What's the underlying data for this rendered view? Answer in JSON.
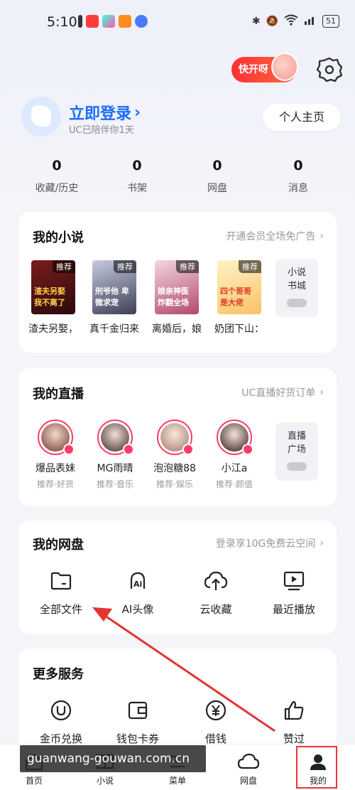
{
  "status_bar": {
    "time": "5:10",
    "battery": "51"
  },
  "header": {
    "promo_badge": "快开呀"
  },
  "profile": {
    "login_label": "立即登录",
    "subtitle": "UC已陪伴你1天",
    "profile_button": "个人主页"
  },
  "stats": [
    {
      "value": "0",
      "label": "收藏/历史"
    },
    {
      "value": "0",
      "label": "书架"
    },
    {
      "value": "0",
      "label": "网盘"
    },
    {
      "value": "0",
      "label": "消息"
    }
  ],
  "novels": {
    "title": "我的小说",
    "link": "开通会员全场免广告",
    "books": [
      {
        "name": "渣夫另娶，",
        "tag": "推荐",
        "cover_text": "渣夫另娶 我不离了"
      },
      {
        "name": "真千金归来",
        "tag": "推荐",
        "cover_text": "刑爷他 卑微求宠"
      },
      {
        "name": "离婚后，娘",
        "tag": "推荐",
        "cover_text": "娘亲神医 炸翻全场"
      },
      {
        "name": "奶团下山：",
        "tag": "推荐",
        "cover_text": "四个哥哥 是大佬"
      }
    ],
    "more_tile": [
      "小说",
      "书城"
    ]
  },
  "live": {
    "title": "我的直播",
    "link": "UC直播好货订单",
    "streamers": [
      {
        "name": "爆品表妹",
        "sub": "推荐·好货"
      },
      {
        "name": "MG雨晴",
        "sub": "推荐·音乐"
      },
      {
        "name": "泡泡糖88",
        "sub": "推荐·娱乐"
      },
      {
        "name": "小江a",
        "sub": "推荐·颜值"
      }
    ],
    "more_tile": [
      "直播",
      "广场"
    ]
  },
  "netdisk": {
    "title": "我的网盘",
    "link": "登录享10G免费云空间",
    "items": [
      {
        "label": "全部文件",
        "icon": "folder-icon"
      },
      {
        "label": "AI头像",
        "icon": "ai-avatar-icon"
      },
      {
        "label": "云收藏",
        "icon": "cloud-upload-icon"
      },
      {
        "label": "最近播放",
        "icon": "play-screen-icon"
      }
    ]
  },
  "services": {
    "title": "更多服务",
    "items": [
      {
        "label": "金币兑换",
        "icon": "coin-icon"
      },
      {
        "label": "钱包卡券",
        "icon": "wallet-icon"
      },
      {
        "label": "借钱",
        "icon": "yuan-icon"
      },
      {
        "label": "赞过",
        "icon": "thumbs-up-icon"
      }
    ]
  },
  "bottom_nav": [
    {
      "label": "首页",
      "icon": "home-icon"
    },
    {
      "label": "小说",
      "icon": "book-icon"
    },
    {
      "label": "菜单",
      "icon": "menu-icon"
    },
    {
      "label": "网盘",
      "icon": "cloud-icon"
    },
    {
      "label": "我的",
      "icon": "profile-icon"
    }
  ],
  "watermark": "guanwang-gouwan.com.cn",
  "colors": {
    "accent": "#1b6cff",
    "live_ring": "#ff3a6a",
    "promo": "#ff2f38",
    "annotation": "#e33333"
  }
}
